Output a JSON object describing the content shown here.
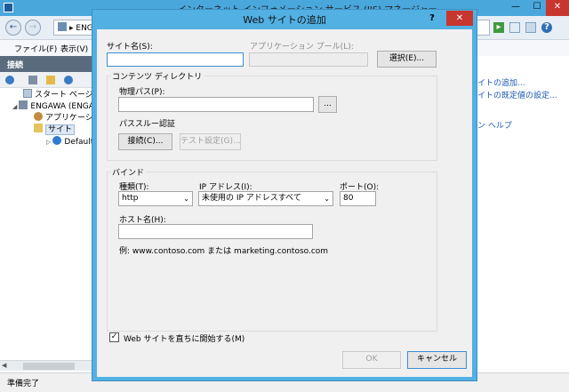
{
  "window": {
    "title": "インターネット インフォメーション サービス (IIS) マネージャー"
  },
  "address_bar": {
    "path": "ENG"
  },
  "menu": {
    "file": "ファイル(F)",
    "view": "表示(V)"
  },
  "connections": {
    "header": "接続",
    "tree": {
      "start_page": "スタート ページ",
      "server": "ENGAWA (ENGA",
      "app_pools": "アプリケーション",
      "sites": "サイト",
      "default_site": "Default W"
    }
  },
  "actions": {
    "add_site": "イトの追加...",
    "defaults": "イトの既定値の設定...",
    "help": "ン ヘルプ"
  },
  "status_bar": {
    "text": "準備完了"
  },
  "dialog": {
    "title": "Web サイトの追加",
    "site_name_label": "サイト名(S):",
    "site_name_value": "",
    "app_pool_label": "アプリケーション プール(L):",
    "app_pool_value": "",
    "select_button": "選択(E)...",
    "content_dir_title": "コンテンツ ディレクトリ",
    "physical_path_label": "物理パス(P):",
    "physical_path_value": "",
    "browse_button": "...",
    "passthrough_label": "パススルー認証",
    "connect_button": "接続(C)...",
    "test_settings_button": "テスト設定(G)...",
    "binding_title": "バインド",
    "type_label": "種類(T):",
    "type_value": "http",
    "ip_label": "IP アドレス(I):",
    "ip_value": "未使用の IP アドレスすべて",
    "port_label": "ポート(O):",
    "port_value": "80",
    "host_label": "ホスト名(H):",
    "host_value": "",
    "example_text": "例: www.contoso.com または marketing.contoso.com",
    "start_checkbox_label": "Web サイトを直ちに開始する(M)",
    "start_checked": true,
    "ok_button": "OK",
    "cancel_button": "キャンセル"
  }
}
